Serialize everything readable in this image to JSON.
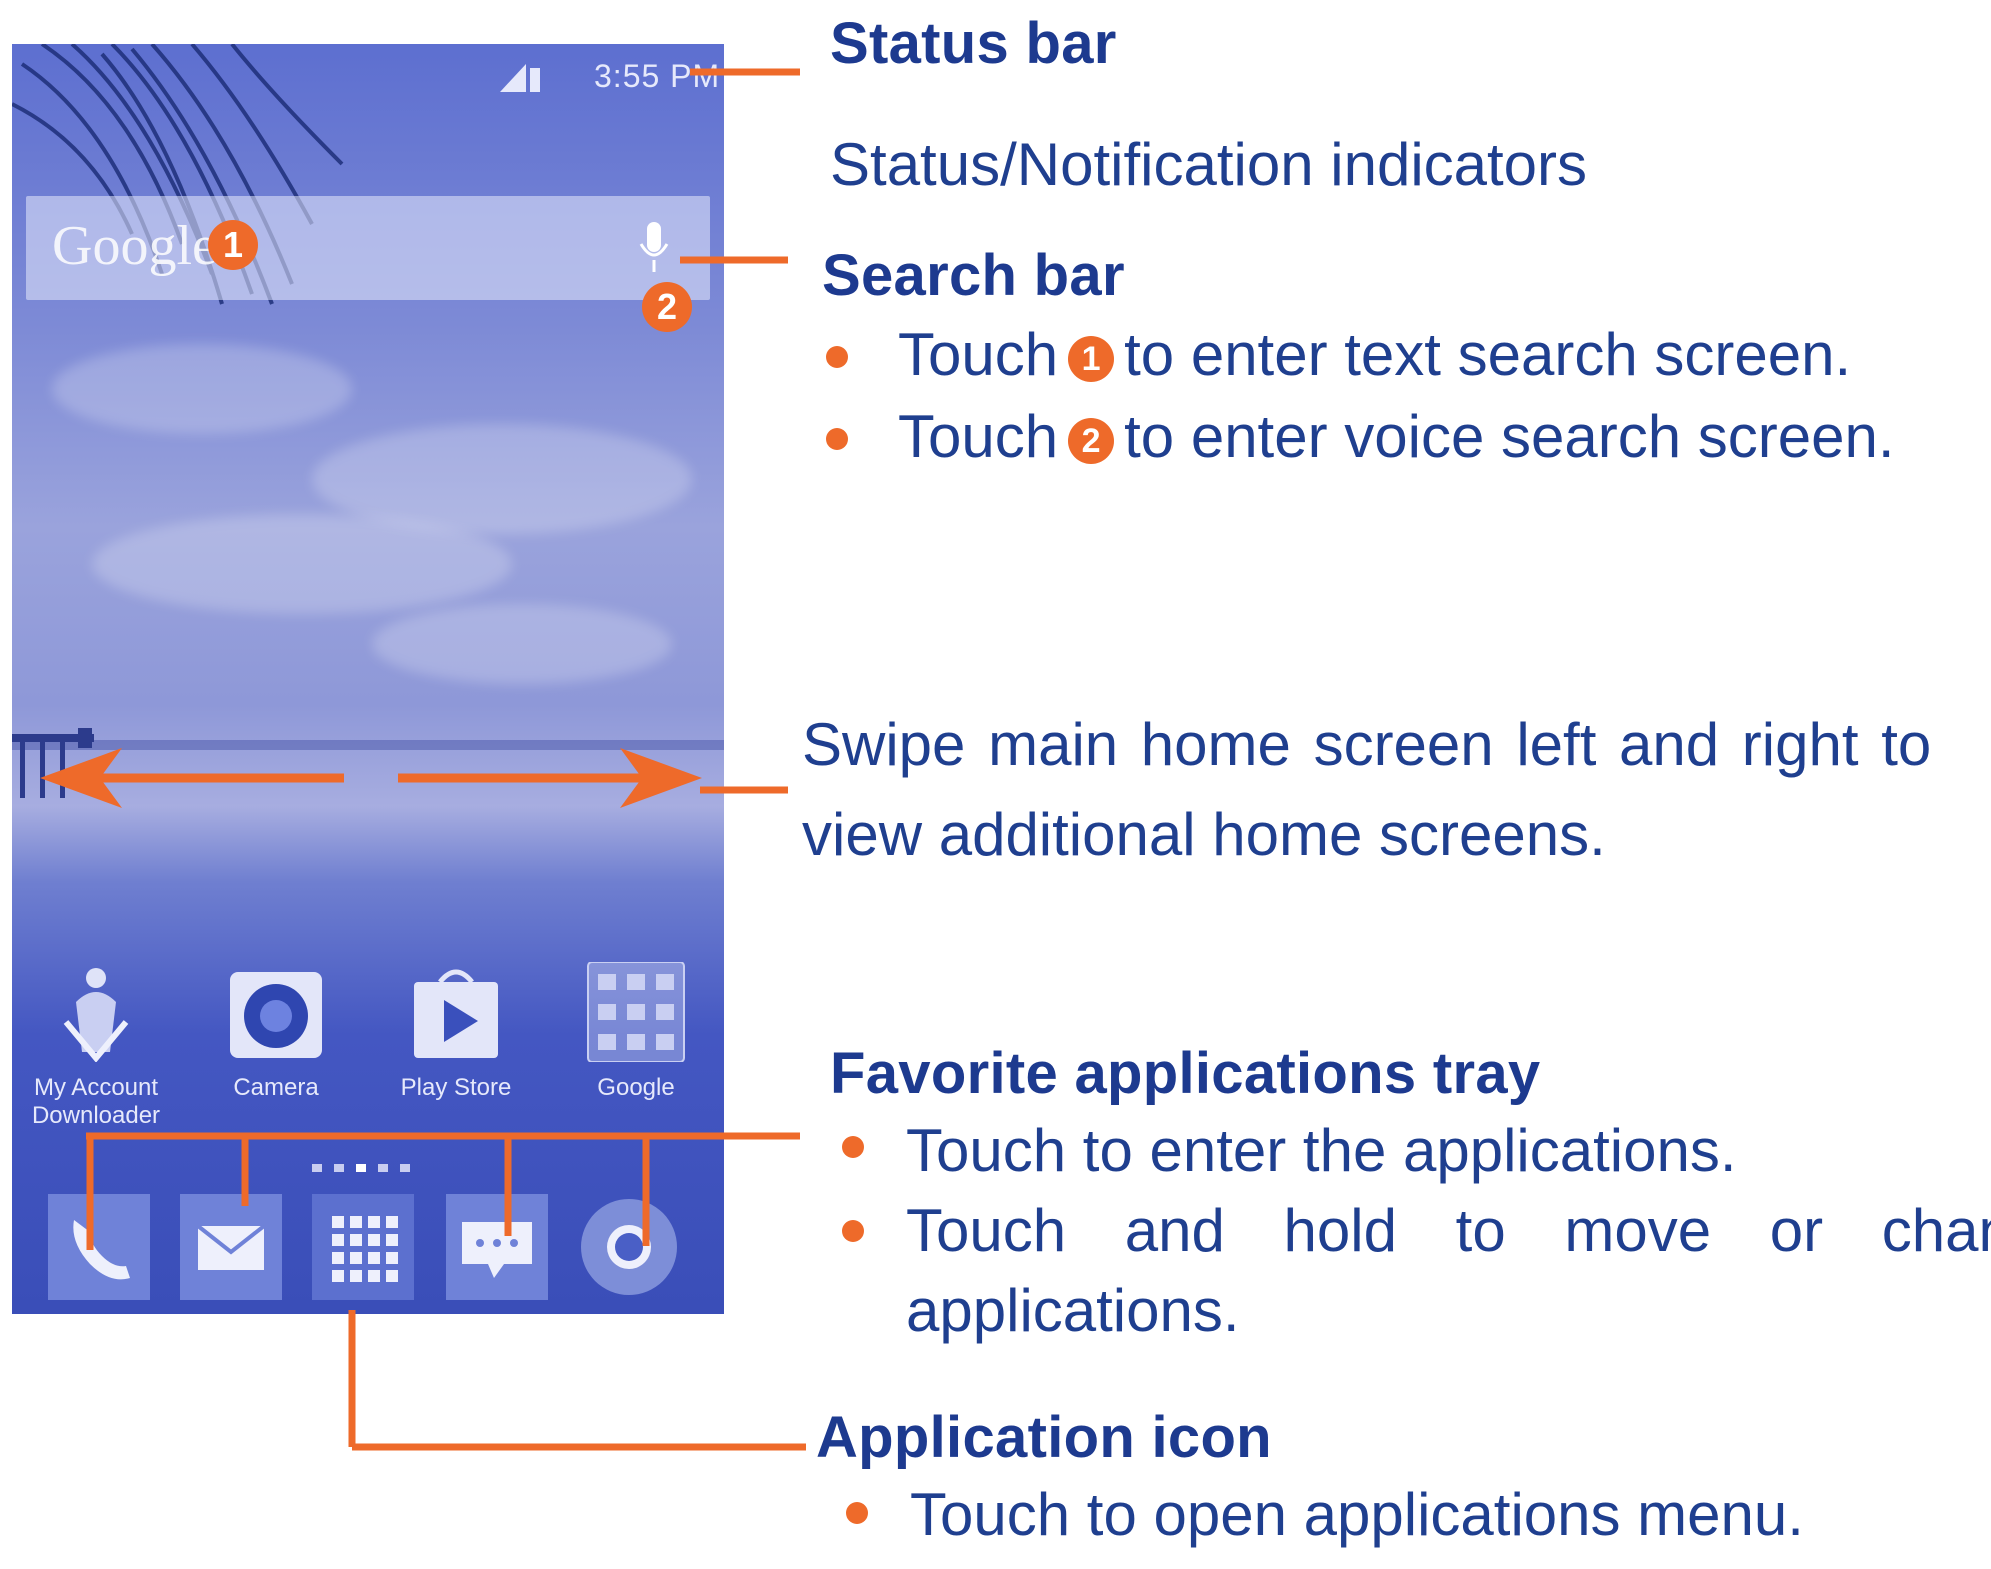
{
  "phone": {
    "status_bar": {
      "time": "3:55 PM"
    },
    "search_bar": {
      "google_logo": "Google",
      "badge_1": "1",
      "badge_2": "2"
    },
    "apps": [
      {
        "label": "My Account Downloader",
        "icon": "account-downloader-icon"
      },
      {
        "label": "Camera",
        "icon": "camera-icon"
      },
      {
        "label": "Play Store",
        "icon": "play-store-icon"
      },
      {
        "label": "Google",
        "icon": "google-folder-icon"
      }
    ],
    "dock": [
      {
        "icon": "phone-icon"
      },
      {
        "icon": "email-icon"
      },
      {
        "icon": "app-drawer-icon"
      },
      {
        "icon": "messaging-icon"
      },
      {
        "icon": "chrome-icon"
      }
    ]
  },
  "annotations": {
    "status_bar_heading": "Status bar",
    "status_bar_desc": "Status/Notification indicators",
    "search_bar_heading": "Search bar",
    "search_touch_word": "Touch",
    "search_bullet_1_rest": "to enter text search screen.",
    "search_bullet_2_rest": "to enter voice search screen.",
    "swipe_line_1": "Swipe main home screen left and right to",
    "swipe_line_2": "view additional home screens.",
    "favorites_heading": "Favorite applications tray",
    "favorites_bullet_1": "Touch to enter the applications.",
    "favorites_bullet_2_line_1": "Touch and hold to move or change",
    "favorites_bullet_2_line_2": "applications.",
    "app_icon_heading": "Application icon",
    "app_icon_bullet": "Touch to open applications menu."
  },
  "colors": {
    "accent": "#ee6a2a",
    "text": "#1f3f8f",
    "screen": "#5d6fd0"
  }
}
